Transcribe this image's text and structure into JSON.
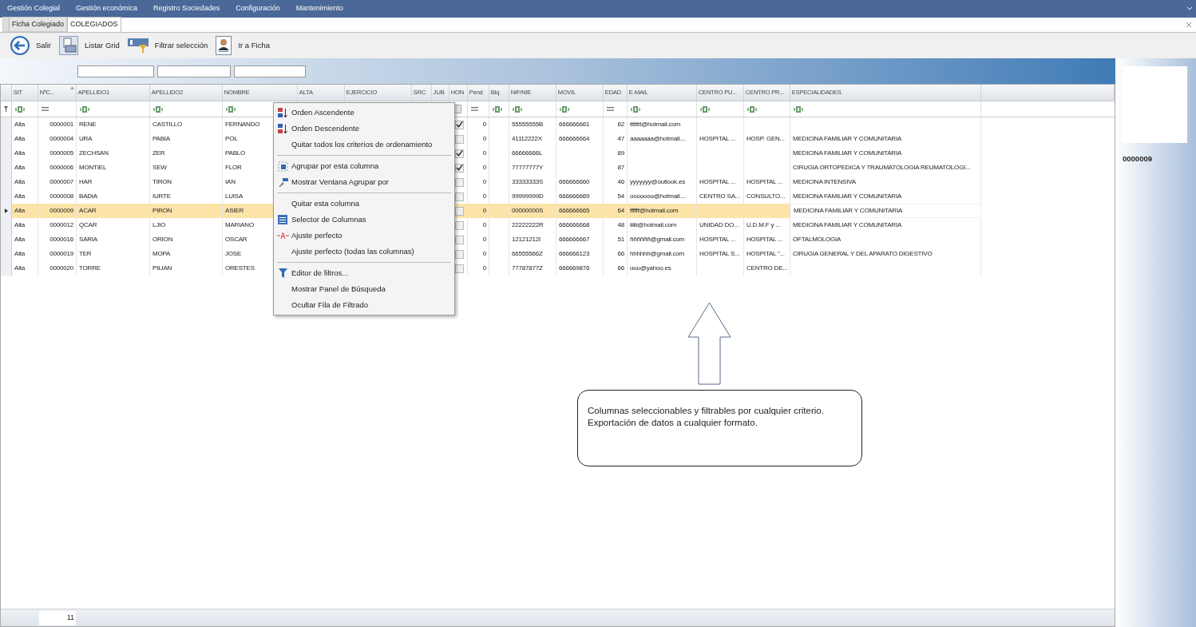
{
  "menu_bar": {
    "items": [
      "Gestión Colegial",
      "Gestión económica",
      "Registro Sociedades",
      "Configuración",
      "Mantenimiento"
    ]
  },
  "tabs": [
    {
      "label": "Ficha Colegiado",
      "selected": false
    },
    {
      "label": "COLEGIADOS",
      "selected": true
    }
  ],
  "toolbar": [
    {
      "kind": "back",
      "label": "Salir"
    },
    {
      "kind": "print",
      "label": "Listar Grid"
    },
    {
      "kind": "filter",
      "label": "Filtrar selección"
    },
    {
      "kind": "person",
      "label": "Ir a Ficha"
    }
  ],
  "grid": {
    "columns": [
      {
        "label": "SIT",
        "kind": "text",
        "sorted": false
      },
      {
        "label": "NºC...",
        "kind": "number",
        "sorted": true
      },
      {
        "label": "APELLIDO1",
        "kind": "text",
        "sorted": false
      },
      {
        "label": "APELLIDO2",
        "kind": "text",
        "sorted": false
      },
      {
        "label": "NOMBRE",
        "kind": "text",
        "sorted": false
      },
      {
        "label": "ALTA",
        "kind": "covered",
        "sorted": false
      },
      {
        "label": "EJERCICIO",
        "kind": "covered",
        "sorted": false
      },
      {
        "label": "SRC",
        "kind": "covered",
        "sorted": false
      },
      {
        "label": "JUB",
        "kind": "covered",
        "sorted": false
      },
      {
        "label": "HON",
        "kind": "check",
        "sorted": false
      },
      {
        "label": "Pend",
        "kind": "number",
        "sorted": false
      },
      {
        "label": "Blq",
        "kind": "text",
        "sorted": false
      },
      {
        "label": "NIF/NIE",
        "kind": "text",
        "sorted": false
      },
      {
        "label": "MOVIL",
        "kind": "text",
        "sorted": false
      },
      {
        "label": "EDAD",
        "kind": "number",
        "sorted": false
      },
      {
        "label": "E-MAIL",
        "kind": "text",
        "sorted": false
      },
      {
        "label": "CENTRO PU...",
        "kind": "text",
        "sorted": false
      },
      {
        "label": "CENTRO PR...",
        "kind": "text",
        "sorted": false
      },
      {
        "label": "ESPECIALIDADES",
        "kind": "text",
        "sorted": false
      }
    ],
    "rows": [
      {
        "selected": false,
        "sit": "Alta",
        "num": "0000001",
        "apellido1": "RENE",
        "apellido2": "CASTILLO",
        "nombre": "FERNANDO",
        "hon": true,
        "pend": "0",
        "nif": "55555555B",
        "movil": "666666661",
        "edad": "62",
        "email": "ttttttt@hotmail.com"
      },
      {
        "selected": false,
        "sit": "Alta",
        "num": "0000004",
        "apellido1": "URA",
        "apellido2": "PABIA",
        "nombre": "POL",
        "hon": false,
        "pend": "0",
        "nif": "41112222X",
        "movil": "666666664",
        "edad": "47",
        "email": "aaaaaaa@hotmail....",
        "centro_pu": "HOSPITAL ...",
        "centro_pr": "HOSP. GEN...",
        "especialidades": "MEDICINA FAMILIAR Y COMUNITARIA"
      },
      {
        "selected": false,
        "sit": "Alta",
        "num": "0000005",
        "apellido1": "ZECHSAN",
        "apellido2": "ZER",
        "nombre": "PABLO",
        "hon": true,
        "pend": "0",
        "nif": "66666666L",
        "edad": "89",
        "especialidades": "MEDICINA FAMILIAR Y COMUNITARIA"
      },
      {
        "selected": false,
        "sit": "Alta",
        "num": "0000006",
        "apellido1": "MONTIEL",
        "apellido2": "SEW",
        "nombre": "FLOR",
        "hon": true,
        "pend": "0",
        "nif": "77777777Y",
        "edad": "87",
        "especialidades": "CIRUGIA ORTOPEDICA Y TRAUMATOLOGIA REUMATOLOGI..."
      },
      {
        "selected": false,
        "sit": "Alta",
        "num": "0000007",
        "apellido1": "HAR",
        "apellido2": "TIRON",
        "nombre": "IAN",
        "hon": false,
        "pend": "0",
        "nif": "33333333S",
        "movil": "666666660",
        "edad": "46",
        "email": "yyyyyyy@outlook.es",
        "centro_pu": "HOSPITAL ...",
        "centro_pr": "HOSPITAL ...",
        "especialidades": "MEDICINA INTENSIVA"
      },
      {
        "selected": false,
        "sit": "Alta",
        "num": "0000008",
        "apellido1": "BADIA",
        "apellido2": "IURTE",
        "nombre": "LUISA",
        "hon": false,
        "pend": "0",
        "nif": "99999999D",
        "movil": "666666669",
        "edad": "54",
        "email": "ooooooo@hotmail....",
        "centro_pu": "CENTRO SA...",
        "centro_pr": "CONSULTO...",
        "especialidades": "MEDICINA FAMILIAR Y COMUNITARIA"
      },
      {
        "selected": true,
        "sit": "Alta",
        "num": "0000009",
        "apellido1": "ACAR",
        "apellido2": "PIRON",
        "nombre": "ASIER",
        "hon": false,
        "pend": "0",
        "nif": "00000000S",
        "movil": "666666665",
        "edad": "64",
        "email": "ffffff@hotmail.com",
        "especialidades": "MEDICINA FAMILIAR Y COMUNITARIA"
      },
      {
        "selected": false,
        "sit": "Alta",
        "num": "0000012",
        "apellido1": "QCAR",
        "apellido2": "LJIO",
        "nombre": "MARIANO",
        "hon": false,
        "pend": "0",
        "nif": "22222222R",
        "movil": "666666668",
        "edad": "48",
        "email": "iiiiii@hotmail.com",
        "centro_pu": "UNIDAD DO...",
        "centro_pr": "U.D.M.F y ...",
        "especialidades": "MEDICINA FAMILIAR Y COMUNITARIA"
      },
      {
        "selected": false,
        "sit": "Alta",
        "num": "0000016",
        "apellido1": "SARIA",
        "apellido2": "ORION",
        "nombre": "OSCAR",
        "hon": false,
        "pend": "0",
        "nif": "12121212I",
        "movil": "666666667",
        "edad": "51",
        "email": "ññññññ@gmail.com",
        "centro_pu": "HOSPITAL ...",
        "centro_pr": "HOSPITAL ...",
        "especialidades": "OFTALMOLOGIA"
      },
      {
        "selected": false,
        "sit": "Alta",
        "num": "0000019",
        "apellido1": "TER",
        "apellido2": "MOPA",
        "nombre": "JOSE",
        "hon": false,
        "pend": "0",
        "nif": "66555566Z",
        "movil": "666666123",
        "edad": "66",
        "email": "hhhhhh@gmail.com",
        "centro_pu": "HOSPITAL S...",
        "centro_pr": "HOSPITAL \"...",
        "especialidades": "CIRUGIA GENERAL Y DEL APARATO DIGESTIVO"
      },
      {
        "selected": false,
        "sit": "Alta",
        "num": "0000020",
        "apellido1": "TORRE",
        "apellido2": "PILIAN",
        "nombre": "ORESTES",
        "hon": false,
        "pend": "0",
        "nif": "77787877Z",
        "movil": "666669876",
        "edad": "66",
        "email": "uuu@yahoo.es",
        "centro_pr": "CENTRO DE..."
      }
    ],
    "record_count": "11"
  },
  "context_menu": [
    {
      "kind": "sort-asc",
      "label": "Orden Ascendente"
    },
    {
      "kind": "sort-desc",
      "label": "Orden Descendente"
    },
    {
      "kind": "plain",
      "label": "Quitar todos los criterios de ordenamiento"
    },
    {
      "kind": "separator"
    },
    {
      "kind": "group",
      "label": "Agrupar por esta columna"
    },
    {
      "kind": "group-window",
      "label": "Mostrar Ventana Agrupar por"
    },
    {
      "kind": "separator"
    },
    {
      "kind": "plain",
      "label": "Quitar esta columna"
    },
    {
      "kind": "columns",
      "label": "Selector de Columnas"
    },
    {
      "kind": "fit",
      "label": "Ajuste perfecto"
    },
    {
      "kind": "plain",
      "label": "Ajuste perfecto (todas las columnas)"
    },
    {
      "kind": "separator"
    },
    {
      "kind": "filter",
      "label": "Editor de filtros..."
    },
    {
      "kind": "plain",
      "label": "Mostrar Panel de Búsqueda"
    },
    {
      "kind": "plain",
      "label": "Ocultar Fila de Filtrado"
    }
  ],
  "side_panel": {
    "code": "0000009"
  },
  "callout": {
    "lines": [
      "Columnas seleccionables y filtrables por cualquier criterio.",
      "Exportación de datos a cualquier formato."
    ]
  }
}
